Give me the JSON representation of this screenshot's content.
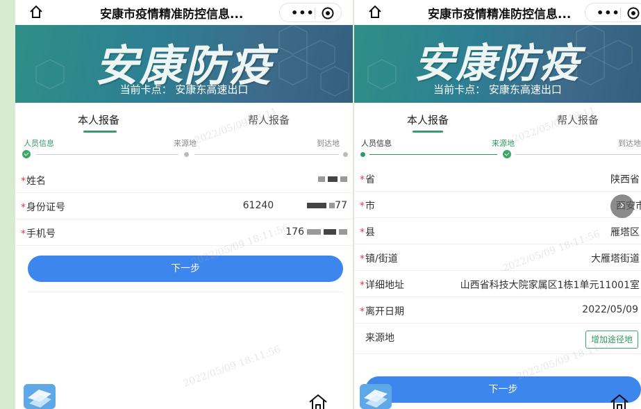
{
  "left": {
    "topbar": {
      "title": "安康市疫情精准防控信息...",
      "dots": "•••"
    },
    "banner": {
      "big": "安康防疫",
      "checkpoint": "当前卡点： 安康东高速出口"
    },
    "tabs": [
      {
        "label": "本人报备"
      },
      {
        "label": "帮人报备"
      }
    ],
    "steps": [
      {
        "label": "人员信息"
      },
      {
        "label": "来源地"
      },
      {
        "label": "到达地"
      }
    ],
    "fields": [
      {
        "label": "姓名",
        "value": ""
      },
      {
        "label": "身份证号",
        "value": "61240",
        "tail": "77"
      },
      {
        "label": "手机号",
        "value": "176"
      }
    ],
    "next": "下一步",
    "watermarks": [
      "2022/05/09 18:11",
      "2022/05/09 18:11:56",
      "2022/05/09 18:11:56"
    ]
  },
  "right": {
    "topbar": {
      "title": "安康市疫情精准防控信息...",
      "dots": "•••"
    },
    "banner": {
      "big": "安康防疫",
      "checkpoint": "当前卡点： 安康东高速出口"
    },
    "tabs": [
      {
        "label": "本人报备"
      },
      {
        "label": "帮人报备"
      }
    ],
    "steps": [
      {
        "label": "人员信息"
      },
      {
        "label": "来源地"
      },
      {
        "label": "到达地"
      }
    ],
    "fields": [
      {
        "label": "省",
        "value": "陕西省"
      },
      {
        "label": "市",
        "value": "西安市"
      },
      {
        "label": "县",
        "value": "雁塔区"
      },
      {
        "label": "镇/街道",
        "value": "大雁塔街道"
      },
      {
        "label": "详细地址",
        "value": "山西省科技大院家属区1栋1单元11001室"
      },
      {
        "label": "离开日期",
        "value": "2022/05/09"
      }
    ],
    "origin_label": "来源地",
    "add_waypoint": "增加途径地",
    "next": "下一步",
    "watermarks": [
      "2022/05/09 18:11",
      "2022/05/09 18:11:56",
      "2022/05/09 18:11:56"
    ]
  },
  "colors": {
    "accent_green": "#2f9a64",
    "button_blue": "#3d86ee",
    "required_red": "#e23b3b"
  }
}
